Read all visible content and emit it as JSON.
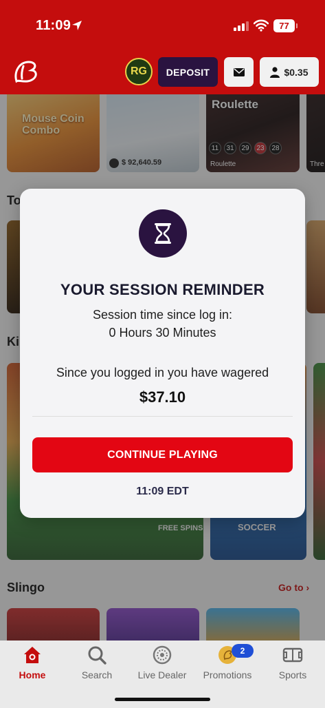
{
  "status_bar": {
    "time": "11:09",
    "battery": "77"
  },
  "header": {
    "rg_badge": "RG",
    "deposit_label": "DEPOSIT",
    "balance": "$0.35",
    "colors": {
      "brand_red": "#c40d0d",
      "deposit_bg": "#2a1340"
    }
  },
  "games_row_1": [
    {
      "title": "Mouse Coin Combo"
    },
    {
      "jackpot": "$ 92,640.59"
    },
    {
      "title": "Roulette",
      "label": "Roulette",
      "numbers": [
        "11",
        "31",
        "29",
        "23",
        "28"
      ]
    },
    {
      "label": "Thre"
    }
  ],
  "sections": {
    "top_partial": "To",
    "kings_partial": "Ki",
    "slingo": {
      "title": "Slingo",
      "goto": "Go to"
    }
  },
  "banner_labels": {
    "soccer": "SOCCER",
    "free_spins": "FREE SPINS"
  },
  "modal": {
    "title": "YOUR SESSION REMINDER",
    "session_label": "Session time since log in:",
    "session_duration": "0 Hours 30 Minutes",
    "wager_label": "Since you logged in you have wagered",
    "wager_amount": "$37.10",
    "continue_label": "CONTINUE PLAYING",
    "timestamp": "11:09 EDT",
    "icon": "hourglass-icon"
  },
  "bottom_nav": {
    "items": [
      {
        "label": "Home",
        "icon": "home-icon",
        "active": true
      },
      {
        "label": "Search",
        "icon": "search-icon"
      },
      {
        "label": "Live Dealer",
        "icon": "roulette-wheel-icon"
      },
      {
        "label": "Promotions",
        "icon": "promotions-icon",
        "badge": "2"
      },
      {
        "label": "Sports",
        "icon": "sports-field-icon"
      }
    ]
  }
}
